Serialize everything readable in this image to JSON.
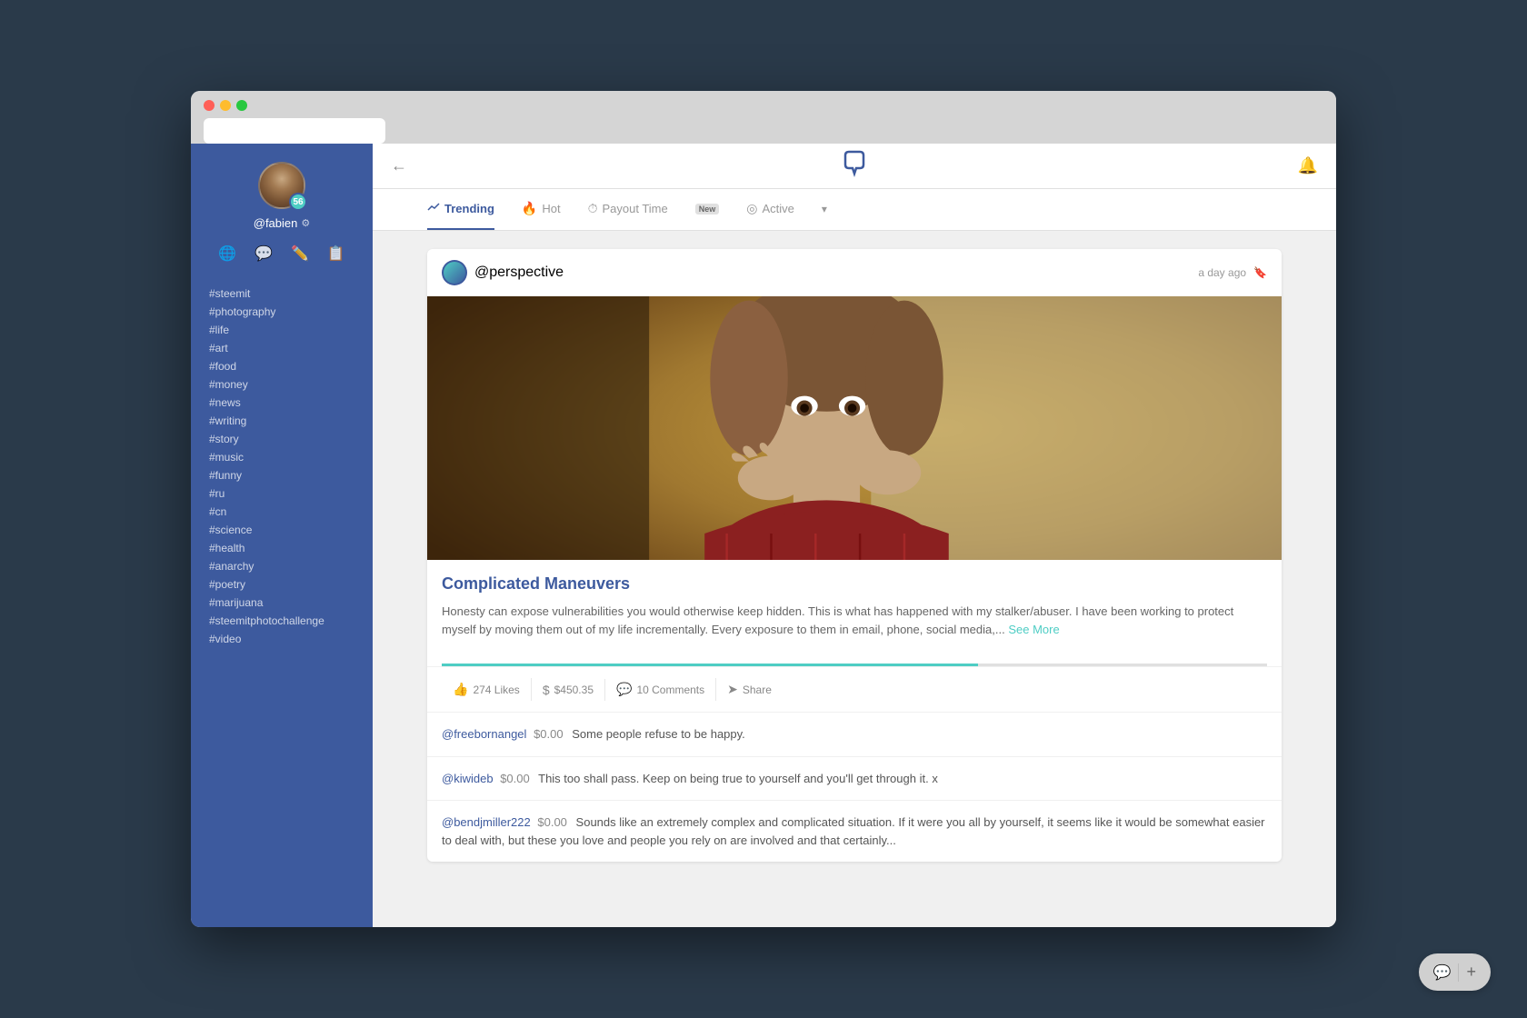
{
  "browser": {
    "address": ""
  },
  "sidebar": {
    "username": "@fabien",
    "badge": "56",
    "hashtags": [
      "#steemit",
      "#photography",
      "#life",
      "#art",
      "#food",
      "#money",
      "#news",
      "#writing",
      "#story",
      "#music",
      "#funny",
      "#ru",
      "#cn",
      "#science",
      "#health",
      "#anarchy",
      "#poetry",
      "#marijuana",
      "#steemitphotochallenge",
      "#video"
    ],
    "nav_icons": [
      "globe",
      "comment",
      "pencil",
      "book"
    ]
  },
  "top_nav": {
    "logo": "U",
    "back_title": "Back",
    "notification_title": "Notifications"
  },
  "tab_bar": {
    "tabs": [
      {
        "label": "Trending",
        "icon": "📈",
        "active": true
      },
      {
        "label": "Hot",
        "icon": "🔥",
        "active": false
      },
      {
        "label": "Payout Time",
        "icon": "⏰",
        "active": false
      },
      {
        "label": "New",
        "icon": "NEW",
        "active": false,
        "badge": true
      },
      {
        "label": "Active",
        "icon": "◎",
        "active": false
      }
    ],
    "more_label": "▾"
  },
  "post": {
    "author": "@perspective",
    "time": "a day ago",
    "title": "Complicated Maneuvers",
    "excerpt": "Honesty can expose vulnerabilities you would otherwise keep hidden. This is what has happened with my stalker/abuser. I have been working to protect myself by moving them out of my life incrementally. Every exposure to them in email, phone, social media,...",
    "see_more": "See More",
    "likes": "274 Likes",
    "amount": "$450.35",
    "comments_count": "10 Comments",
    "share": "Share"
  },
  "comments": [
    {
      "author": "@freebornangel",
      "amount": "$0.00",
      "text": "Some people refuse to be happy."
    },
    {
      "author": "@kiwideb",
      "amount": "$0.00",
      "text": "This too shall pass. Keep on being true to yourself and you'll get through it. x"
    },
    {
      "author": "@bendjmiller222",
      "amount": "$0.00",
      "text": "Sounds like an extremely complex and complicated situation. If it were you all by yourself, it seems like it would be somewhat easier to deal with, but these you love and people you rely on are involved and that certainly..."
    }
  ],
  "fab": {
    "chat": "💬",
    "plus": "+"
  }
}
